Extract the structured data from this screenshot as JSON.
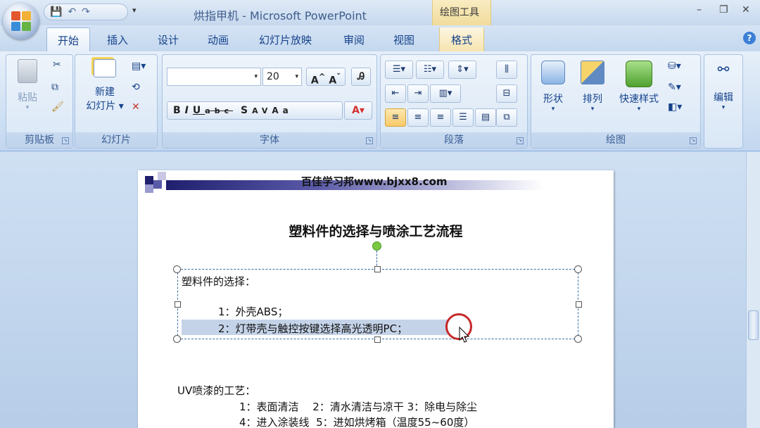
{
  "window": {
    "title": "烘指甲机 - Microsoft PowerPoint",
    "context_tab_group": "绘图工具",
    "controls": [
      "–",
      "❐",
      "✕"
    ]
  },
  "tabs": [
    "开始",
    "插入",
    "设计",
    "动画",
    "幻灯片放映",
    "审阅",
    "视图"
  ],
  "context_tab": "格式",
  "ribbon": {
    "clipboard": {
      "paste": "粘贴",
      "label": "剪贴板"
    },
    "slides": {
      "new_slide_line1": "新建",
      "new_slide_line2": "幻灯片",
      "label": "幻灯片"
    },
    "font": {
      "font_name": "",
      "font_size": "20",
      "label": "字体"
    },
    "paragraph": {
      "label": "段落"
    },
    "drawing": {
      "shape": "形状",
      "arrange": "排列",
      "quick_styles": "快速样式",
      "label": "绘图"
    },
    "editing": {
      "label": "编辑"
    }
  },
  "slide": {
    "site": "百佳学习邦www.bjxx8.com",
    "title": "塑料件的选择与喷涂工艺流程",
    "box_heading": "塑料件的选择：",
    "item1": "1：外壳ABS；",
    "item2": "2：灯带壳与触控按键选择高光透明PC；",
    "uv_heading": "UV喷漆的工艺：",
    "uv_line1": "1：表面清洁　 2：清水清洁与凉干 3：除电与除尘",
    "uv_line2": "4：进入涂装线  5：进如烘烤箱（温度55~60度）"
  }
}
